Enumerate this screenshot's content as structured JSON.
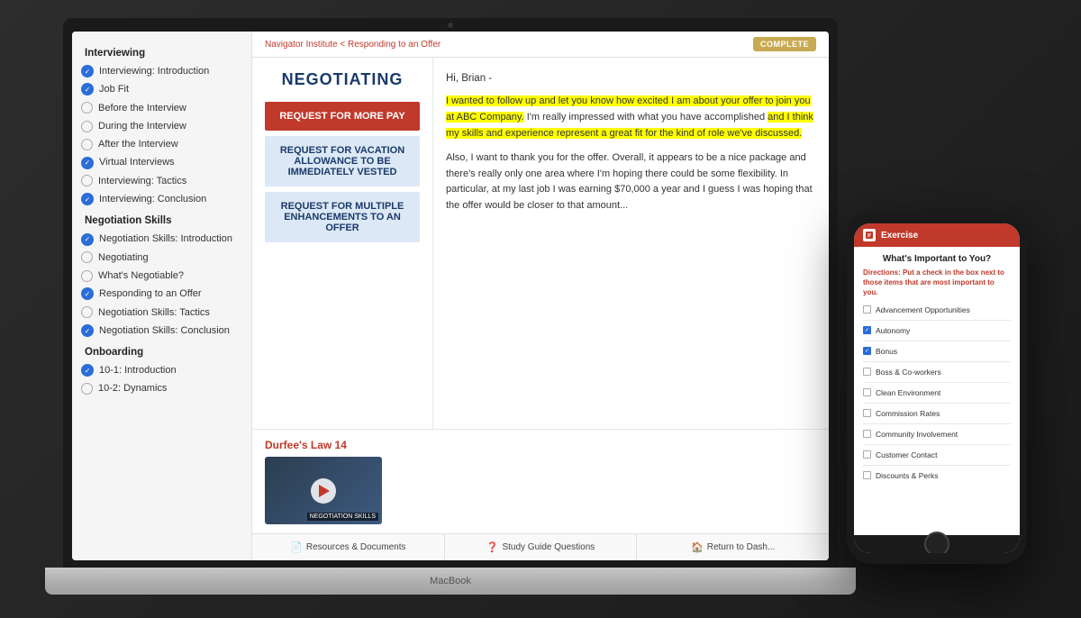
{
  "scene": {
    "background": "#1a1a2e"
  },
  "macbook": {
    "label": "MacBook",
    "camera_alt": "camera"
  },
  "sidebar": {
    "sections": [
      {
        "title": "Interviewing",
        "items": [
          {
            "label": "Interviewing: Introduction",
            "checked": true
          },
          {
            "label": "Job Fit",
            "checked": true
          },
          {
            "label": "Before the Interview",
            "checked": false
          },
          {
            "label": "During the Interview",
            "checked": false
          },
          {
            "label": "After the Interview",
            "checked": false
          },
          {
            "label": "Virtual Interviews",
            "checked": true
          },
          {
            "label": "Interviewing: Tactics",
            "checked": false
          },
          {
            "label": "Interviewing: Conclusion",
            "checked": true
          }
        ]
      },
      {
        "title": "Negotiation Skills",
        "items": [
          {
            "label": "Negotiation Skills: Introduction",
            "checked": true
          },
          {
            "label": "Negotiating",
            "checked": false
          },
          {
            "label": "What's Negotiable?",
            "checked": false
          },
          {
            "label": "Responding to an Offer",
            "checked": true
          },
          {
            "label": "Negotiation Skills: Tactics",
            "checked": false
          },
          {
            "label": "Negotiation Skills: Conclusion",
            "checked": true
          }
        ]
      },
      {
        "title": "Onboarding",
        "items": [
          {
            "label": "10-1: Introduction",
            "checked": true
          },
          {
            "label": "10-2: Dynamics",
            "checked": false
          }
        ]
      }
    ]
  },
  "topbar": {
    "breadcrumb": "Navigator Institute < Responding to an Offer",
    "badge": "COMPLETE"
  },
  "left_panel": {
    "title": "NEGOTIATING",
    "menu_items": [
      {
        "label": "REQUEST FOR MORE PAY",
        "active": true
      },
      {
        "label": "REQUEST FOR VACATION ALLOWANCE TO BE IMMEDIATELY VESTED",
        "active": false
      },
      {
        "label": "REQUEST FOR MULTIPLE ENHANCEMENTS TO AN OFFER",
        "active": false
      }
    ]
  },
  "email": {
    "greeting": "Hi, Brian -",
    "paragraph1_normal1": "I wanted to follow up and let you know how excited I am about your offer to join you at ABC Company.",
    "paragraph1_normal2": " I'm really impressed with what you have accomplished ",
    "paragraph1_highlight2": "and I think my skills and experience represent a great fit for the kind of role we've discussed.",
    "paragraph2": "Also, I want to thank you for the offer.  Overall, it appears to be a nice package and there's really only one area where I'm hoping there could be some flexibility.  In particular, at my last job I was earning $70,000 a year and I guess I was hoping that the offer would be closer to that amount..."
  },
  "video": {
    "title": "Durfee's Law 14",
    "label": "NEGOTIATION SKILLS"
  },
  "bottom_bar": {
    "buttons": [
      {
        "icon": "doc-icon",
        "label": "Resources & Documents"
      },
      {
        "icon": "question-icon",
        "label": "Study Guide Questions"
      },
      {
        "icon": "home-icon",
        "label": "Return to Dash..."
      }
    ]
  },
  "phone": {
    "header": {
      "icon_alt": "exercise-icon",
      "title": "Exercise"
    },
    "body": {
      "title": "What's Important to You?",
      "directions_label": "Directions:",
      "directions_text": " Put a check in the box next to those items that are most important to you.",
      "items": [
        {
          "label": "Advancement Opportunities",
          "checked": false
        },
        {
          "label": "Autonomy",
          "checked": true
        },
        {
          "label": "Bonus",
          "checked": true
        },
        {
          "label": "Boss & Co-workers",
          "checked": false
        },
        {
          "label": "Clean Environment",
          "checked": false
        },
        {
          "label": "Commission Rates",
          "checked": false
        },
        {
          "label": "Community Involvement",
          "checked": false
        },
        {
          "label": "Customer Contact",
          "checked": false
        },
        {
          "label": "Discounts & Perks",
          "checked": false
        }
      ]
    }
  }
}
